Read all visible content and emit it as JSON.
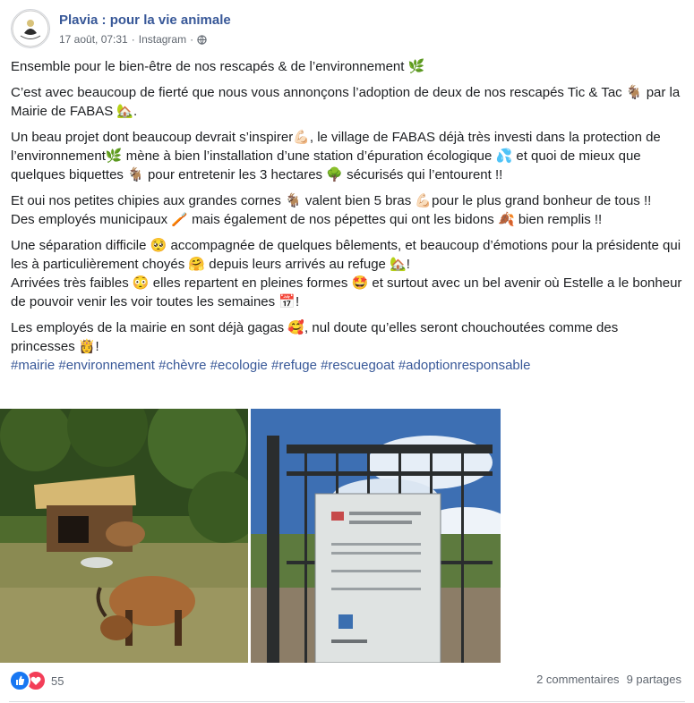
{
  "post": {
    "page_name": "Plavia : pour la vie animale",
    "avatar_text": "Plavia",
    "date": "17 août, 07:31",
    "source": "Instagram",
    "separator": "·"
  },
  "body": {
    "p1": "Ensemble pour le bien-être de nos rescapés & de l’environnement 🌿",
    "p2": "C’est avec beaucoup de fierté que nous vous annonçons l’adoption de deux de nos rescapés Tic & Tac 🐐 par la Mairie de FABAS 🏡.",
    "p3": "Un beau projet dont beaucoup devrait s’inspirer💪🏻, le village de FABAS déjà très investi dans la protection de l’environnement🌿 mène à bien l’installation d’une station d’épuration écologique 💦 et quoi de mieux que quelques biquettes 🐐 pour entretenir les 3 hectares 🌳 sécurisés qui l’entourent !!",
    "p4": "Et oui nos petites chipies aux grandes cornes 🐐 valent bien 5 bras 💪🏻pour le plus grand bonheur de tous !!\nDes employés municipaux 🪥 mais également de nos pépettes qui ont les bidons 🍂 bien remplis !!",
    "p5": "Une séparation difficile 🥺 accompagnée de quelques bêlements, et beaucoup d’émotions pour la présidente qui les à particulièrement choyés 🤗 depuis leurs arrivés au refuge 🏡!\nArrivées très faibles 😳 elles repartent en pleines formes 🤩 et surtout avec un bel avenir où Estelle a le bonheur de pouvoir venir les voir toutes les semaines 📅!",
    "p6": "Les employés de la mairie en sont déjà gagas 🥰, nul doute qu’elles seront chouchoutées comme des princesses 👸!",
    "hashtags": [
      "#mairie",
      "#environnement",
      "#chèvre",
      "#ecologie",
      "#refuge",
      "#rescuegoat",
      "#adoptionresponsable"
    ]
  },
  "photos": {
    "left_alt": "goats",
    "right_alt": "gate sign"
  },
  "footer": {
    "reaction_count": "55",
    "comments": "2 commentaires",
    "shares": "9 partages"
  },
  "colors": {
    "link": "#385898",
    "meta": "#606770",
    "like": "#1877f2",
    "love": "#f33e58"
  }
}
